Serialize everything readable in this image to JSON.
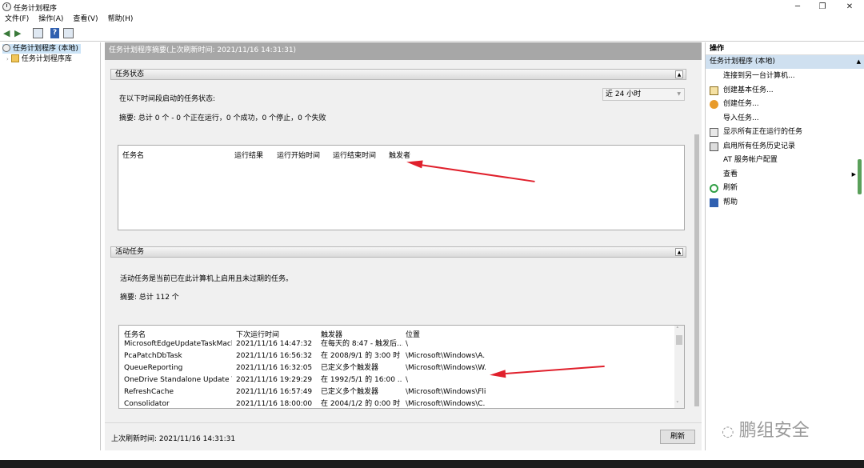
{
  "window": {
    "title": "任务计划程序",
    "controls": [
      "─",
      "❐",
      "✕"
    ]
  },
  "menu": [
    "文件(F)",
    "操作(A)",
    "查看(V)",
    "帮助(H)"
  ],
  "tree": {
    "root": "任务计划程序 (本地)",
    "child": "任务计划程序库"
  },
  "center": {
    "header": "任务计划程序摘要(上次刷新时间: 2021/11/16 14:31:31)",
    "status_section": {
      "title": "任务状态",
      "prompt": "在以下时间段启动的任务状态:",
      "range": "近 24 小时",
      "summary": "摘要: 总计 0 个 - 0 个正在运行，0 个成功，0 个停止，0 个失败",
      "columns": [
        "任务名",
        "运行结果",
        "运行开始时间",
        "运行结束时间",
        "触发者"
      ]
    },
    "active_section": {
      "title": "活动任务",
      "description": "活动任务是当前已在此计算机上启用且未过期的任务。",
      "summary": "摘要: 总计 112 个",
      "columns": [
        "任务名",
        "下次运行时间",
        "触发器",
        "位置"
      ],
      "rows": [
        [
          "MicrosoftEdgeUpdateTaskMachin...",
          "2021/11/16 14:47:32",
          "在每天的 8:47 - 触发后...",
          "\\"
        ],
        [
          "PcaPatchDbTask",
          "2021/11/16 16:56:32",
          "在 2008/9/1 的 3:00 时 ...",
          "\\Microsoft\\Windows\\A..."
        ],
        [
          "QueueReporting",
          "2021/11/16 16:32:05",
          "已定义多个触发器",
          "\\Microsoft\\Windows\\W..."
        ],
        [
          "OneDrive Standalone Update Tas...",
          "2021/11/16 19:29:29",
          "在 1992/5/1 的 16:00 ...",
          "\\"
        ],
        [
          "RefreshCache",
          "2021/11/16 16:57:49",
          "已定义多个触发器",
          "\\Microsoft\\Windows\\Fli..."
        ],
        [
          "Consolidator",
          "2021/11/16 18:00:00",
          "在 2004/1/2 的 0:00 时 ...",
          "\\Microsoft\\Windows\\C..."
        ]
      ]
    },
    "footer_text": "上次刷新时间: 2021/11/16 14:31:31",
    "refresh_button": "刷新"
  },
  "actions": {
    "title": "操作",
    "subtitle": "任务计划程序 (本地)",
    "items": [
      {
        "label": "连接到另一台计算机...",
        "icon": "none"
      },
      {
        "label": "创建基本任务...",
        "icon": "wizard-icon"
      },
      {
        "label": "创建任务...",
        "icon": "task-icon"
      },
      {
        "label": "导入任务...",
        "icon": "none"
      },
      {
        "label": "显示所有正在运行的任务",
        "icon": "list-icon"
      },
      {
        "label": "启用所有任务历史记录",
        "icon": "history-icon"
      },
      {
        "label": "AT 服务帐户配置",
        "icon": "none"
      },
      {
        "label": "查看",
        "icon": "none"
      },
      {
        "label": "刷新",
        "icon": "refresh-icon"
      },
      {
        "label": "帮助",
        "icon": "help-icon"
      }
    ]
  },
  "watermark": "鹏组安全",
  "colors": {
    "annotation_arrow": "#e0202c",
    "header_bg": "#a7a7a7",
    "selected_bg": "#cfe0f0"
  }
}
